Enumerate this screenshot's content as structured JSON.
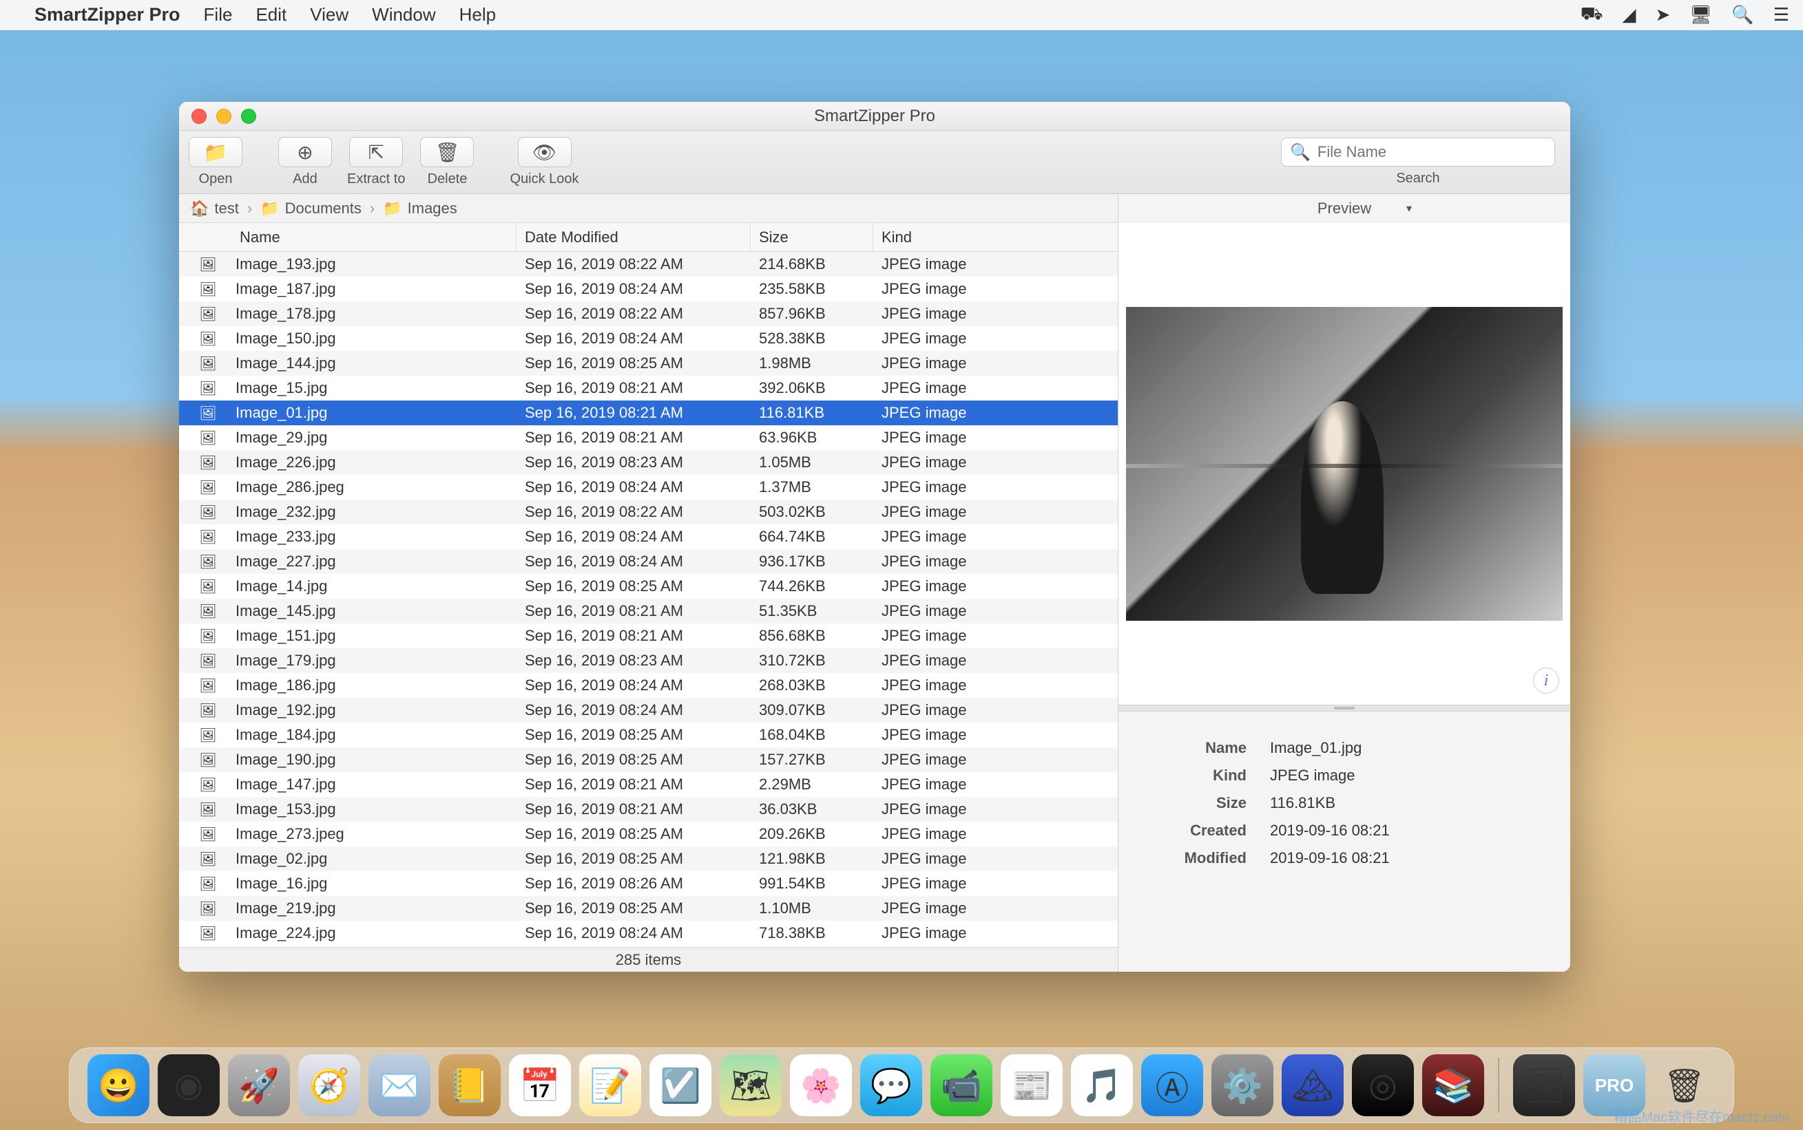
{
  "menubar": {
    "app_name": "SmartZipper Pro",
    "items": [
      "File",
      "Edit",
      "View",
      "Window",
      "Help"
    ]
  },
  "window": {
    "title": "SmartZipper Pro",
    "toolbar": {
      "open": "Open",
      "add": "Add",
      "extract": "Extract to",
      "delete": "Delete",
      "quicklook": "Quick Look",
      "search_label": "Search",
      "search_placeholder": "File Name"
    },
    "breadcrumb": {
      "root": "test",
      "seg1": "Documents",
      "seg2": "Images"
    },
    "columns": {
      "name": "Name",
      "date": "Date Modified",
      "size": "Size",
      "kind": "Kind"
    },
    "files": [
      {
        "name": "Image_193.jpg",
        "date": "Sep 16, 2019 08:22 AM",
        "size": "214.68KB",
        "kind": "JPEG image"
      },
      {
        "name": "Image_187.jpg",
        "date": "Sep 16, 2019 08:24 AM",
        "size": "235.58KB",
        "kind": "JPEG image"
      },
      {
        "name": "Image_178.jpg",
        "date": "Sep 16, 2019 08:22 AM",
        "size": "857.96KB",
        "kind": "JPEG image"
      },
      {
        "name": "Image_150.jpg",
        "date": "Sep 16, 2019 08:24 AM",
        "size": "528.38KB",
        "kind": "JPEG image"
      },
      {
        "name": "Image_144.jpg",
        "date": "Sep 16, 2019 08:25 AM",
        "size": "1.98MB",
        "kind": "JPEG image"
      },
      {
        "name": "Image_15.jpg",
        "date": "Sep 16, 2019 08:21 AM",
        "size": "392.06KB",
        "kind": "JPEG image"
      },
      {
        "name": "Image_01.jpg",
        "date": "Sep 16, 2019 08:21 AM",
        "size": "116.81KB",
        "kind": "JPEG image",
        "selected": true
      },
      {
        "name": "Image_29.jpg",
        "date": "Sep 16, 2019 08:21 AM",
        "size": "63.96KB",
        "kind": "JPEG image"
      },
      {
        "name": "Image_226.jpg",
        "date": "Sep 16, 2019 08:23 AM",
        "size": "1.05MB",
        "kind": "JPEG image"
      },
      {
        "name": "Image_286.jpeg",
        "date": "Sep 16, 2019 08:24 AM",
        "size": "1.37MB",
        "kind": "JPEG image"
      },
      {
        "name": "Image_232.jpg",
        "date": "Sep 16, 2019 08:22 AM",
        "size": "503.02KB",
        "kind": "JPEG image"
      },
      {
        "name": "Image_233.jpg",
        "date": "Sep 16, 2019 08:24 AM",
        "size": "664.74KB",
        "kind": "JPEG image"
      },
      {
        "name": "Image_227.jpg",
        "date": "Sep 16, 2019 08:24 AM",
        "size": "936.17KB",
        "kind": "JPEG image"
      },
      {
        "name": "Image_14.jpg",
        "date": "Sep 16, 2019 08:25 AM",
        "size": "744.26KB",
        "kind": "JPEG image"
      },
      {
        "name": "Image_145.jpg",
        "date": "Sep 16, 2019 08:21 AM",
        "size": "51.35KB",
        "kind": "JPEG image"
      },
      {
        "name": "Image_151.jpg",
        "date": "Sep 16, 2019 08:21 AM",
        "size": "856.68KB",
        "kind": "JPEG image"
      },
      {
        "name": "Image_179.jpg",
        "date": "Sep 16, 2019 08:23 AM",
        "size": "310.72KB",
        "kind": "JPEG image"
      },
      {
        "name": "Image_186.jpg",
        "date": "Sep 16, 2019 08:24 AM",
        "size": "268.03KB",
        "kind": "JPEG image"
      },
      {
        "name": "Image_192.jpg",
        "date": "Sep 16, 2019 08:24 AM",
        "size": "309.07KB",
        "kind": "JPEG image"
      },
      {
        "name": "Image_184.jpg",
        "date": "Sep 16, 2019 08:25 AM",
        "size": "168.04KB",
        "kind": "JPEG image"
      },
      {
        "name": "Image_190.jpg",
        "date": "Sep 16, 2019 08:25 AM",
        "size": "157.27KB",
        "kind": "JPEG image"
      },
      {
        "name": "Image_147.jpg",
        "date": "Sep 16, 2019 08:21 AM",
        "size": "2.29MB",
        "kind": "JPEG image"
      },
      {
        "name": "Image_153.jpg",
        "date": "Sep 16, 2019 08:21 AM",
        "size": "36.03KB",
        "kind": "JPEG image"
      },
      {
        "name": "Image_273.jpeg",
        "date": "Sep 16, 2019 08:25 AM",
        "size": "209.26KB",
        "kind": "JPEG image"
      },
      {
        "name": "Image_02.jpg",
        "date": "Sep 16, 2019 08:25 AM",
        "size": "121.98KB",
        "kind": "JPEG image"
      },
      {
        "name": "Image_16.jpg",
        "date": "Sep 16, 2019 08:26 AM",
        "size": "991.54KB",
        "kind": "JPEG image"
      },
      {
        "name": "Image_219.jpg",
        "date": "Sep 16, 2019 08:25 AM",
        "size": "1.10MB",
        "kind": "JPEG image"
      },
      {
        "name": "Image_224.jpg",
        "date": "Sep 16, 2019 08:24 AM",
        "size": "718.38KB",
        "kind": "JPEG image"
      }
    ],
    "status": "285 items",
    "preview": {
      "header": "Preview",
      "meta": {
        "name_label": "Name",
        "name_value": "Image_01.jpg",
        "kind_label": "Kind",
        "kind_value": "JPEG image",
        "size_label": "Size",
        "size_value": "116.81KB",
        "created_label": "Created",
        "created_value": "2019-09-16 08:21",
        "modified_label": "Modified",
        "modified_value": "2019-09-16 08:21"
      }
    }
  },
  "watermark": "精品Mac软件尽在macfz.com"
}
